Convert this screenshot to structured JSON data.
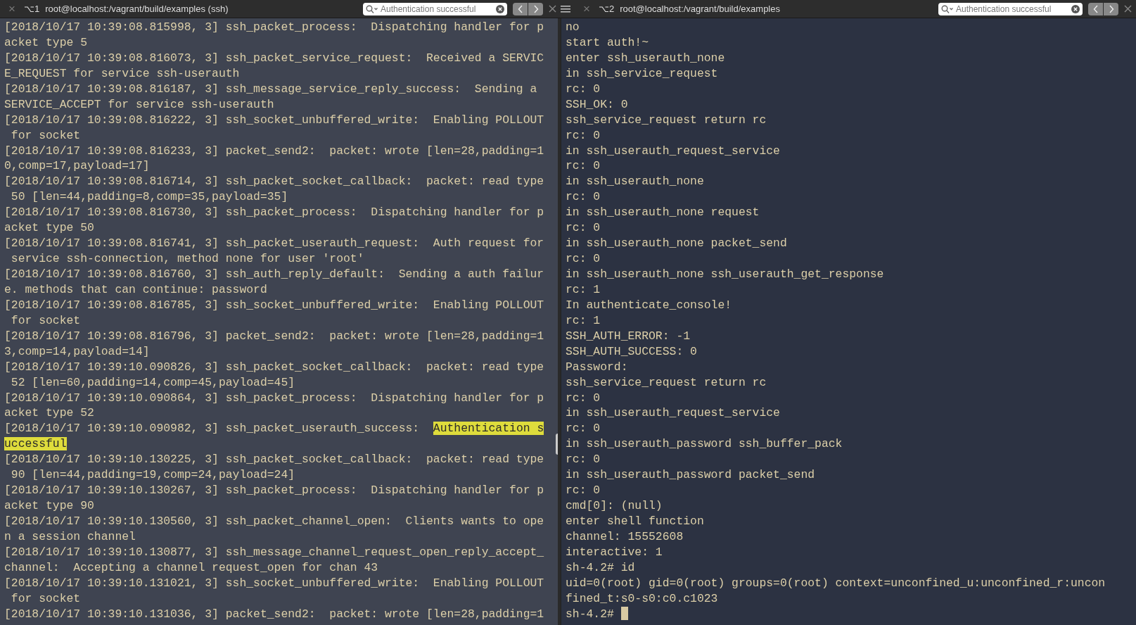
{
  "panes": [
    {
      "tab": {
        "close": "×",
        "shortcut": "⌥1",
        "title": "root@localhost:/vagrant/build/examples (ssh)"
      },
      "search": {
        "value": "Authentication successful"
      },
      "lines": [
        {
          "text": "[2018/10/17 10:39:08.815998, 3] ssh_packet_process:  Dispatching handler for p"
        },
        {
          "text": "acket type 5"
        },
        {
          "text": "[2018/10/17 10:39:08.816073, 3] ssh_packet_service_request:  Received a SERVIC"
        },
        {
          "text": "E_REQUEST for service ssh-userauth"
        },
        {
          "text": "[2018/10/17 10:39:08.816187, 3] ssh_message_service_reply_success:  Sending a "
        },
        {
          "text": "SERVICE_ACCEPT for service ssh-userauth"
        },
        {
          "text": "[2018/10/17 10:39:08.816222, 3] ssh_socket_unbuffered_write:  Enabling POLLOUT"
        },
        {
          "text": " for socket"
        },
        {
          "text": "[2018/10/17 10:39:08.816233, 3] packet_send2:  packet: wrote [len=28,padding=1"
        },
        {
          "text": "0,comp=17,payload=17]"
        },
        {
          "text": "[2018/10/17 10:39:08.816714, 3] ssh_packet_socket_callback:  packet: read type"
        },
        {
          "text": " 50 [len=44,padding=8,comp=35,payload=35]"
        },
        {
          "text": "[2018/10/17 10:39:08.816730, 3] ssh_packet_process:  Dispatching handler for p"
        },
        {
          "text": "acket type 50"
        },
        {
          "text": "[2018/10/17 10:39:08.816741, 3] ssh_packet_userauth_request:  Auth request for"
        },
        {
          "text": " service ssh-connection, method none for user 'root'"
        },
        {
          "text": "[2018/10/17 10:39:08.816760, 3] ssh_auth_reply_default:  Sending a auth failur"
        },
        {
          "text": "e. methods that can continue: password"
        },
        {
          "text": "[2018/10/17 10:39:08.816785, 3] ssh_socket_unbuffered_write:  Enabling POLLOUT"
        },
        {
          "text": " for socket"
        },
        {
          "text": "[2018/10/17 10:39:08.816796, 3] packet_send2:  packet: wrote [len=28,padding=1"
        },
        {
          "text": "3,comp=14,payload=14]"
        },
        {
          "text": "[2018/10/17 10:39:10.090826, 3] ssh_packet_socket_callback:  packet: read type"
        },
        {
          "text": " 52 [len=60,padding=14,comp=45,payload=45]"
        },
        {
          "text": "[2018/10/17 10:39:10.090864, 3] ssh_packet_process:  Dispatching handler for p"
        },
        {
          "text": "acket type 52"
        },
        {
          "segments": [
            {
              "text": "[2018/10/17 10:39:10.090982, 3] ssh_packet_userauth_success:  ",
              "highlighted": false
            },
            {
              "text": "Authentication s",
              "highlighted": true
            }
          ]
        },
        {
          "segments": [
            {
              "text": "uccessful",
              "highlighted": true
            }
          ]
        },
        {
          "text": "[2018/10/17 10:39:10.130225, 3] ssh_packet_socket_callback:  packet: read type"
        },
        {
          "text": " 90 [len=44,padding=19,comp=24,payload=24]"
        },
        {
          "text": "[2018/10/17 10:39:10.130267, 3] ssh_packet_process:  Dispatching handler for p"
        },
        {
          "text": "acket type 90"
        },
        {
          "text": "[2018/10/17 10:39:10.130560, 3] ssh_packet_channel_open:  Clients wants to ope"
        },
        {
          "text": "n a session channel"
        },
        {
          "text": "[2018/10/17 10:39:10.130877, 3] ssh_message_channel_request_open_reply_accept_"
        },
        {
          "text": "channel:  Accepting a channel request_open for chan 43"
        },
        {
          "text": "[2018/10/17 10:39:10.131021, 3] ssh_socket_unbuffered_write:  Enabling POLLOUT"
        },
        {
          "text": " for socket"
        },
        {
          "text": "[2018/10/17 10:39:10.131036, 3] packet_send2:  packet: wrote [len=28,padding=1"
        }
      ],
      "cursor": false
    },
    {
      "tab": {
        "close": "×",
        "shortcut": "⌥2",
        "title": "root@localhost:/vagrant/build/examples"
      },
      "search": {
        "value": "Authentication successful"
      },
      "lines": [
        {
          "text": "no"
        },
        {
          "text": "start auth!~"
        },
        {
          "text": "enter ssh_userauth_none"
        },
        {
          "text": "in ssh_service_request"
        },
        {
          "text": "rc: 0"
        },
        {
          "text": "SSH_OK: 0"
        },
        {
          "text": "ssh_service_request return rc"
        },
        {
          "text": "rc: 0"
        },
        {
          "text": "in ssh_userauth_request_service"
        },
        {
          "text": "rc: 0"
        },
        {
          "text": "in ssh_userauth_none"
        },
        {
          "text": "rc: 0"
        },
        {
          "text": "in ssh_userauth_none request"
        },
        {
          "text": "rc: 0"
        },
        {
          "text": "in ssh_userauth_none packet_send"
        },
        {
          "text": "rc: 0"
        },
        {
          "text": "in ssh_userauth_none ssh_userauth_get_response"
        },
        {
          "text": "rc: 1"
        },
        {
          "text": "In authenticate_console!"
        },
        {
          "text": "rc: 1"
        },
        {
          "text": "SSH_AUTH_ERROR: -1"
        },
        {
          "text": "SSH_AUTH_SUCCESS: 0"
        },
        {
          "text": "Password:"
        },
        {
          "text": "ssh_service_request return rc"
        },
        {
          "text": "rc: 0"
        },
        {
          "text": "in ssh_userauth_request_service"
        },
        {
          "text": "rc: 0"
        },
        {
          "text": "in ssh_userauth_password ssh_buffer_pack"
        },
        {
          "text": "rc: 0"
        },
        {
          "text": "in ssh_userauth_password packet_send"
        },
        {
          "text": "rc: 0"
        },
        {
          "text": "cmd[0]: (null)"
        },
        {
          "text": "enter shell function"
        },
        {
          "text": "channel: 15552608"
        },
        {
          "text": "interactive: 1"
        },
        {
          "text": "sh-4.2# id"
        },
        {
          "text": "uid=0(root) gid=0(root) groups=0(root) context=unconfined_u:unconfined_r:uncon"
        },
        {
          "text": "fined_t:s0-s0:c0.c1023"
        },
        {
          "text": "sh-4.2# "
        }
      ],
      "cursor": true
    }
  ]
}
